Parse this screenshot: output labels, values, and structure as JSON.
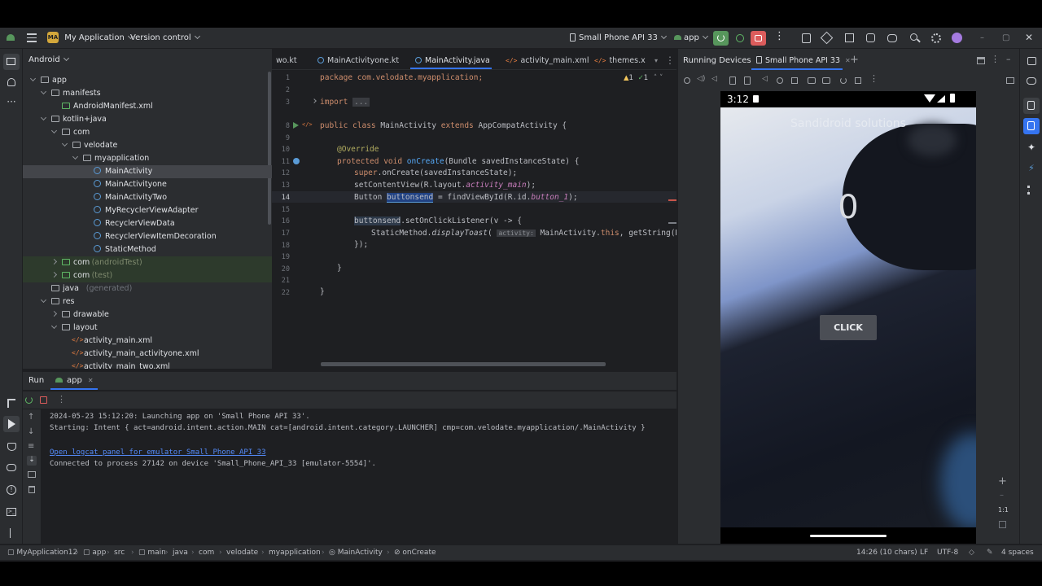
{
  "titlebar": {
    "project_badge": "MA",
    "project_name": "My Application",
    "vcs": "Version control",
    "device": "Small Phone API 33",
    "run_config": "app"
  },
  "project_panel": {
    "view": "Android",
    "tree": [
      {
        "label": "app",
        "depth": 0,
        "type": "folder",
        "open": true
      },
      {
        "label": "manifests",
        "depth": 1,
        "type": "folder",
        "open": true
      },
      {
        "label": "AndroidManifest.xml",
        "depth": 2,
        "type": "manifest"
      },
      {
        "label": "kotlin+java",
        "depth": 1,
        "type": "folder",
        "open": true
      },
      {
        "label": "com",
        "depth": 2,
        "type": "folder",
        "open": true
      },
      {
        "label": "velodate",
        "depth": 3,
        "type": "folder",
        "open": true
      },
      {
        "label": "myapplication",
        "depth": 4,
        "type": "folder",
        "open": true
      },
      {
        "label": "MainActivity",
        "depth": 5,
        "type": "class",
        "selected": true
      },
      {
        "label": "MainActivityone",
        "depth": 5,
        "type": "class"
      },
      {
        "label": "MainActivityTwo",
        "depth": 5,
        "type": "class"
      },
      {
        "label": "MyRecyclerViewAdapter",
        "depth": 5,
        "type": "class"
      },
      {
        "label": "RecyclerViewData",
        "depth": 5,
        "type": "class"
      },
      {
        "label": "RecyclerViewItemDecoration",
        "depth": 5,
        "type": "class"
      },
      {
        "label": "StaticMethod",
        "depth": 5,
        "type": "class"
      },
      {
        "label": "com",
        "suffix": "(androidTest)",
        "depth": 2,
        "type": "folder",
        "open": false,
        "highlight": true
      },
      {
        "label": "com",
        "suffix": "(test)",
        "depth": 2,
        "type": "folder",
        "open": false,
        "highlight": true
      },
      {
        "label": "java",
        "suffix": "(generated)",
        "depth": 1,
        "type": "folder-gen"
      },
      {
        "label": "res",
        "depth": 1,
        "type": "folder",
        "open": true
      },
      {
        "label": "drawable",
        "depth": 2,
        "type": "folder",
        "open": false
      },
      {
        "label": "layout",
        "depth": 2,
        "type": "folder",
        "open": true
      },
      {
        "label": "activity_main.xml",
        "depth": 3,
        "type": "xml"
      },
      {
        "label": "activity_main_activityone.xml",
        "depth": 3,
        "type": "xml"
      },
      {
        "label": "activity_main_two.xml",
        "depth": 3,
        "type": "xml"
      }
    ]
  },
  "editor": {
    "tabs": [
      "wo.kt",
      "MainActivityone.kt",
      "MainActivity.java",
      "activity_main.xml",
      "themes.x"
    ],
    "active_tab": "MainActivity.java",
    "inspections": {
      "warnings": "1",
      "ok": "1"
    },
    "line_numbers": [
      "1",
      "2",
      "3",
      "8",
      "9",
      "10",
      "11",
      "12",
      "13",
      "14",
      "15",
      "16",
      "17",
      "18",
      "19",
      "20",
      "21",
      "22"
    ],
    "code": {
      "l1": [
        "package com.velodate.myapplication;"
      ],
      "l3": [
        "import ",
        "..."
      ],
      "l8_a": "public class ",
      "l8_b": "MainActivity ",
      "l8_c": "extends ",
      "l8_d": "AppCompatActivity {",
      "l10": "@Override",
      "l11_a": "protected void ",
      "l11_b": "onCreate",
      "l11_c": "(Bundle savedInstanceState) {",
      "l12_a": "super",
      "l12_b": ".onCreate(savedInstanceState);",
      "l13_a": "setContentView(R.layout.",
      "l13_b": "activity_main",
      "l13_c": ");",
      "l14_a": "Button ",
      "l14_b": "buttonsend",
      "l14_c": " = findViewById(R.id.",
      "l14_d": "button_1",
      "l14_e": ");",
      "l16_a": "buttonsend",
      "l16_b": ".setOnClickListener(v -> {",
      "l17_a": "StaticMethod.",
      "l17_b": "displayToast",
      "l17_c": "( ",
      "l17_hint": "activity:",
      "l17_d": " MainActivity.",
      "l17_e": "this",
      "l17_f": ", getString(R.string",
      "l18": "});",
      "l20": "}",
      "l22": "}"
    }
  },
  "run_panel": {
    "title": "Run",
    "tab": "app",
    "lines": [
      "2024-05-23 15:12:20: Launching app on 'Small Phone API 33'.",
      "Starting: Intent { act=android.intent.action.MAIN cat=[android.intent.category.LAUNCHER] cmp=com.velodate.myapplication/.MainActivity }",
      "",
      "Open logcat panel for emulator Small Phone API 33",
      "Connected to process 27142 on device 'Small_Phone_API_33 [emulator-5554]'."
    ]
  },
  "devices": {
    "title": "Running Devices",
    "tab": "Small Phone API 33",
    "phone": {
      "time": "3:12",
      "app_title": "Sandidroid solutions",
      "counter": "0",
      "button": "CLICK"
    },
    "zoom_labels": [
      "+",
      "–",
      "1:1"
    ]
  },
  "breadcrumb": [
    "MyApplication12",
    "app",
    "src",
    "main",
    "java",
    "com",
    "velodate",
    "myapplication",
    "MainActivity",
    "onCreate"
  ],
  "status": {
    "position": "14:26 (10 chars)",
    "line_sep": "LF",
    "encoding": "UTF-8",
    "indent": "4 spaces"
  },
  "colors": {
    "accent": "#3574f0",
    "run_green": "#57965c",
    "stop_red": "#db5c5c"
  }
}
